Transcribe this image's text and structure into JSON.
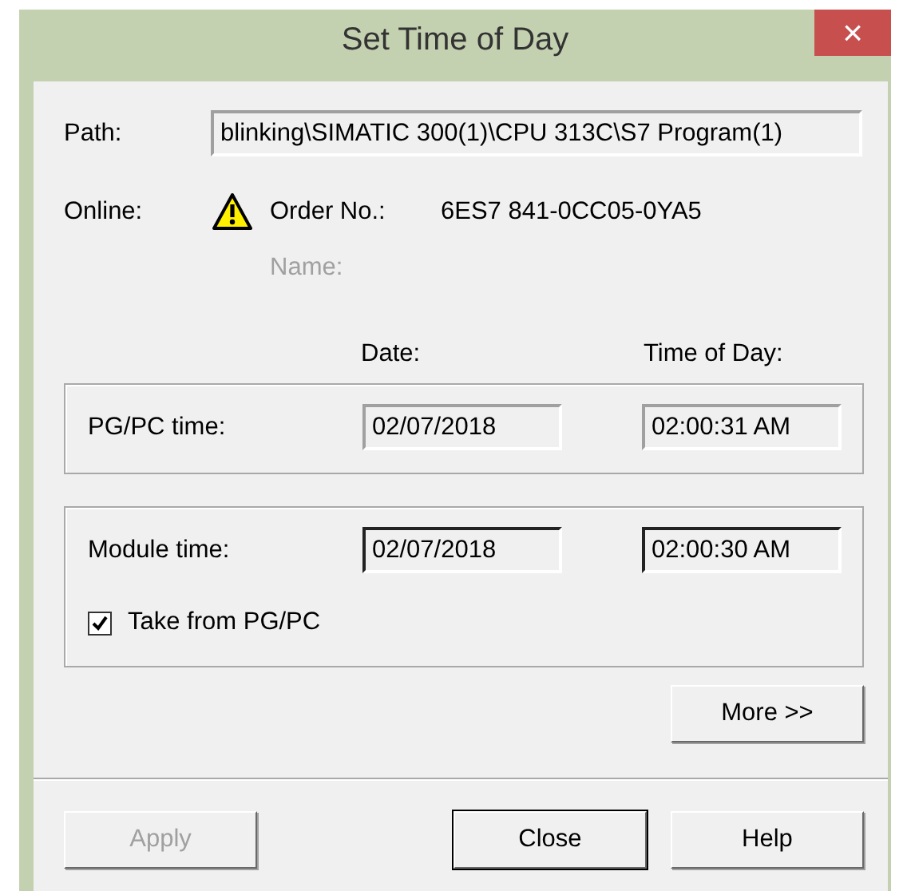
{
  "window": {
    "title": "Set Time of Day",
    "close": "×"
  },
  "path": {
    "label": "Path:",
    "value": "blinking\\SIMATIC 300(1)\\CPU 313C\\S7 Program(1)"
  },
  "online": {
    "label": "Online:",
    "order_label": "Order No.:",
    "order_value": "6ES7 841-0CC05-0YA5",
    "name_label": "Name:"
  },
  "columns": [
    "Date:",
    "Time of Day:"
  ],
  "groups": [
    {
      "label": "PG/PC time:",
      "date": "02/07/2018",
      "time": "02:00:31 AM",
      "readonly": true
    },
    {
      "label": "Module time:",
      "date": "02/07/2018",
      "time": "02:00:30 AM",
      "readonly": false,
      "checkbox": {
        "label": "Take from PG/PC",
        "checked": true
      }
    }
  ],
  "more_button": "More >>",
  "buttons": [
    {
      "label": "Apply",
      "disabled": true,
      "default": false
    },
    {
      "label": "Close",
      "disabled": false,
      "default": true
    },
    {
      "label": "Help",
      "disabled": false,
      "default": false
    }
  ]
}
